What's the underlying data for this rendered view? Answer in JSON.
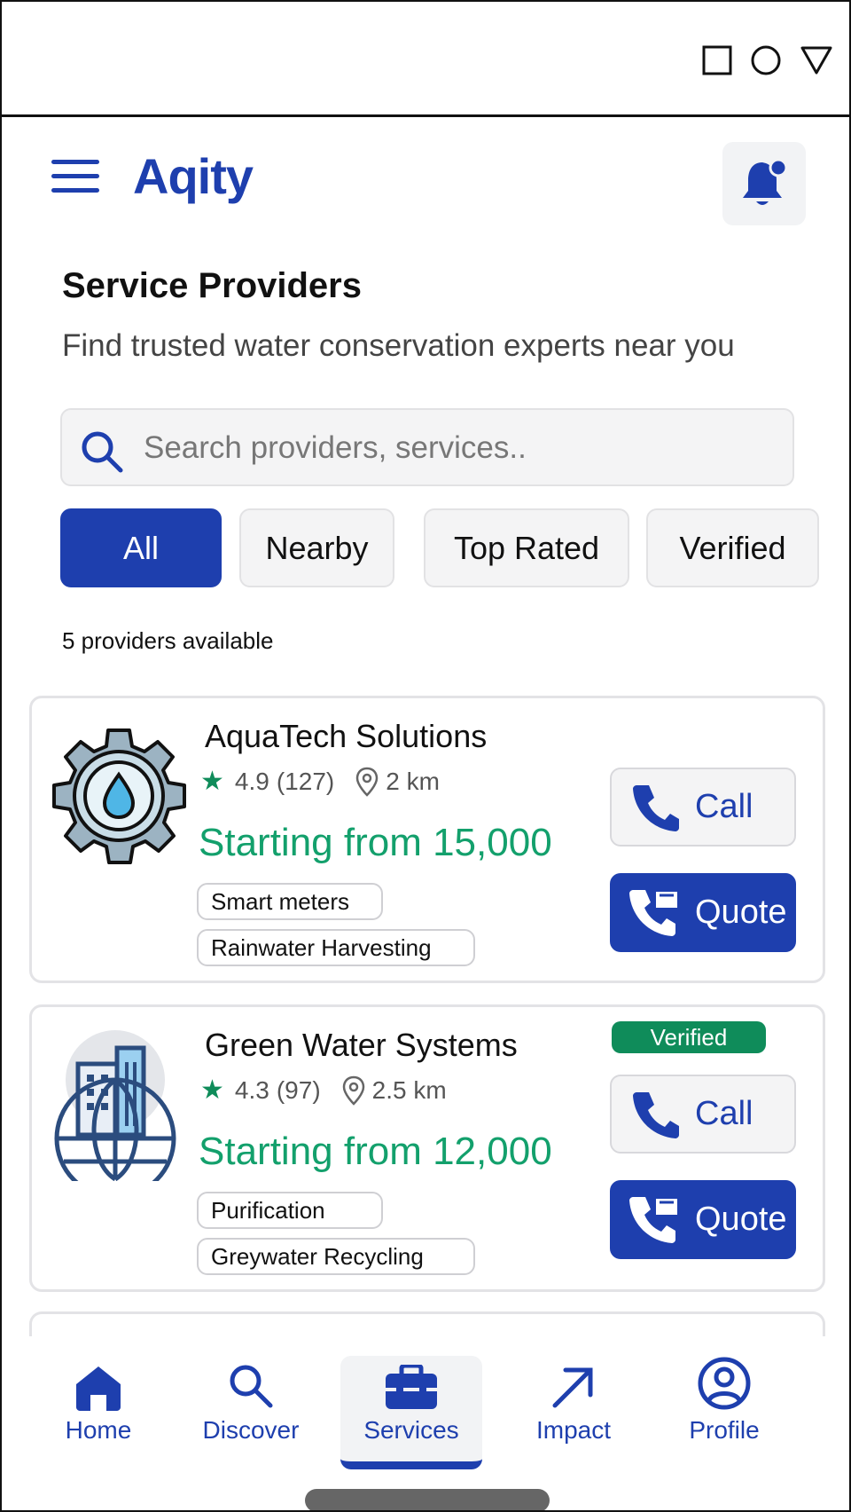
{
  "app": {
    "name": "Aqity"
  },
  "header": {
    "menu_icon": "hamburger-icon",
    "notification_icon": "bell-icon"
  },
  "page": {
    "title": "Service Providers",
    "subtitle": "Find trusted water conservation experts near you"
  },
  "search": {
    "placeholder": "Search providers, services..",
    "value": ""
  },
  "filters": [
    {
      "label": "All",
      "active": true
    },
    {
      "label": "Nearby",
      "active": false
    },
    {
      "label": "Top Rated",
      "active": false
    },
    {
      "label": "Verified",
      "active": false
    }
  ],
  "results_count": "5 providers available",
  "providers": [
    {
      "name": "AquaTech Solutions",
      "rating": "4.9",
      "reviews": "(127)",
      "distance": "2 km",
      "price": "Starting from 15,000",
      "tags": [
        "Smart meters",
        "Rainwater Harvesting"
      ],
      "verified": false,
      "call_label": "Call",
      "quote_label": "Quote",
      "icon": "gear-water-drop-icon"
    },
    {
      "name": "Green Water Systems",
      "rating": "4.3",
      "reviews": "(97)",
      "distance": "2.5 km",
      "price": "Starting from 12,000",
      "tags": [
        "Purification",
        "Greywater Recycling"
      ],
      "verified": true,
      "verified_label": "Verified",
      "call_label": "Call",
      "quote_label": "Quote",
      "icon": "city-globe-icon"
    }
  ],
  "bottom_nav": [
    {
      "label": "Home",
      "icon": "home-icon",
      "active": false
    },
    {
      "label": "Discover",
      "icon": "search-icon",
      "active": false
    },
    {
      "label": "Services",
      "icon": "toolbox-icon",
      "active": true
    },
    {
      "label": "Impact",
      "icon": "arrow-up-right-icon",
      "active": false
    },
    {
      "label": "Profile",
      "icon": "user-circle-icon",
      "active": false
    }
  ],
  "colors": {
    "primary": "#1e3fae",
    "accent_green": "#13a06c",
    "badge_green": "#0f8c5a",
    "chip_bg": "#f4f4f5"
  }
}
